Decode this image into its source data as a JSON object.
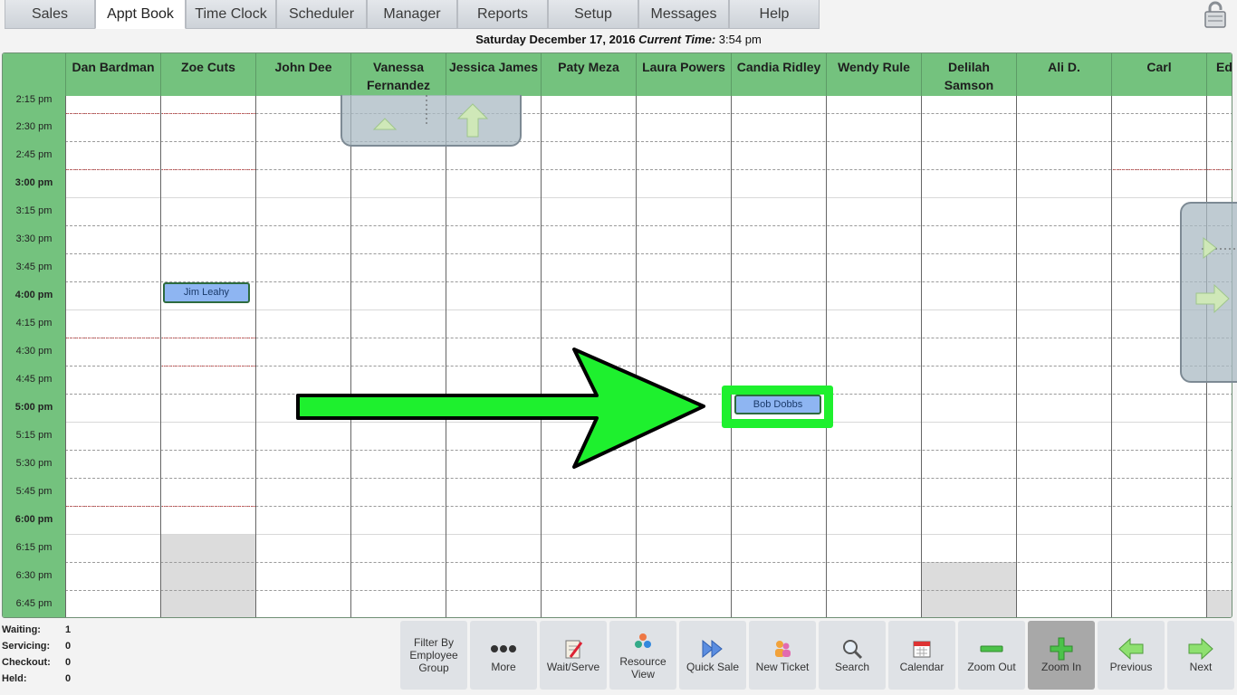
{
  "nav": {
    "tabs": [
      {
        "label": "Sales"
      },
      {
        "label": "Appt Book"
      },
      {
        "label": "Time Clock"
      },
      {
        "label": "Scheduler"
      },
      {
        "label": "Manager"
      },
      {
        "label": "Reports"
      },
      {
        "label": "Setup"
      },
      {
        "label": "Messages"
      },
      {
        "label": "Help"
      }
    ],
    "active": "Appt Book"
  },
  "date_line": {
    "date": "Saturday December 17, 2016",
    "current_time_label": "Current Time:",
    "current_time": "3:54 pm"
  },
  "columns": [
    {
      "name": "Dan Bardman"
    },
    {
      "name": "Zoe Cuts"
    },
    {
      "name": "John Dee"
    },
    {
      "name": "Vanessa Fernandez"
    },
    {
      "name": "Jessica James"
    },
    {
      "name": "Paty Meza"
    },
    {
      "name": "Laura Powers"
    },
    {
      "name": "Candia Ridley"
    },
    {
      "name": "Wendy Rule"
    },
    {
      "name": "Delilah Samson"
    },
    {
      "name": "Ali D."
    },
    {
      "name": "Carl"
    },
    {
      "name": "Ed"
    }
  ],
  "times": [
    "2:15 pm",
    "2:30 pm",
    "2:45 pm",
    "3:00 pm",
    "3:15 pm",
    "3:30 pm",
    "3:45 pm",
    "4:00 pm",
    "4:15 pm",
    "4:30 pm",
    "4:45 pm",
    "5:00 pm",
    "5:15 pm",
    "5:30 pm",
    "5:45 pm",
    "6:00 pm",
    "6:15 pm",
    "6:30 pm",
    "6:45 pm"
  ],
  "appointments": [
    {
      "client": "Jim Leahy",
      "employee": "Zoe Cuts",
      "time": "4:00 pm"
    },
    {
      "client": "Bob Dobbs",
      "employee": "Candia Ridley",
      "time": "5:00 pm"
    }
  ],
  "status": {
    "waiting_label": "Waiting:",
    "waiting": "1",
    "servicing_label": "Servicing:",
    "servicing": "0",
    "checkout_label": "Checkout:",
    "checkout": "0",
    "held_label": "Held:",
    "held": "0"
  },
  "toolbar": {
    "filter_line1": "Filter By",
    "filter_line2": "Employee",
    "filter_line3": "Group",
    "more": "More",
    "wait_serve": "Wait/Serve",
    "resource_line1": "Resource",
    "resource_line2": "View",
    "quick_sale": "Quick Sale",
    "new_ticket": "New Ticket",
    "search": "Search",
    "calendar": "Calendar",
    "zoom_out": "Zoom Out",
    "zoom_in": "Zoom In",
    "previous": "Previous",
    "next": "Next"
  },
  "colors": {
    "header_green": "#74c27e",
    "appointment_blue": "#8eb5f2",
    "highlight_green": "#1ef02e",
    "active_tool": "#a8a8a8"
  }
}
